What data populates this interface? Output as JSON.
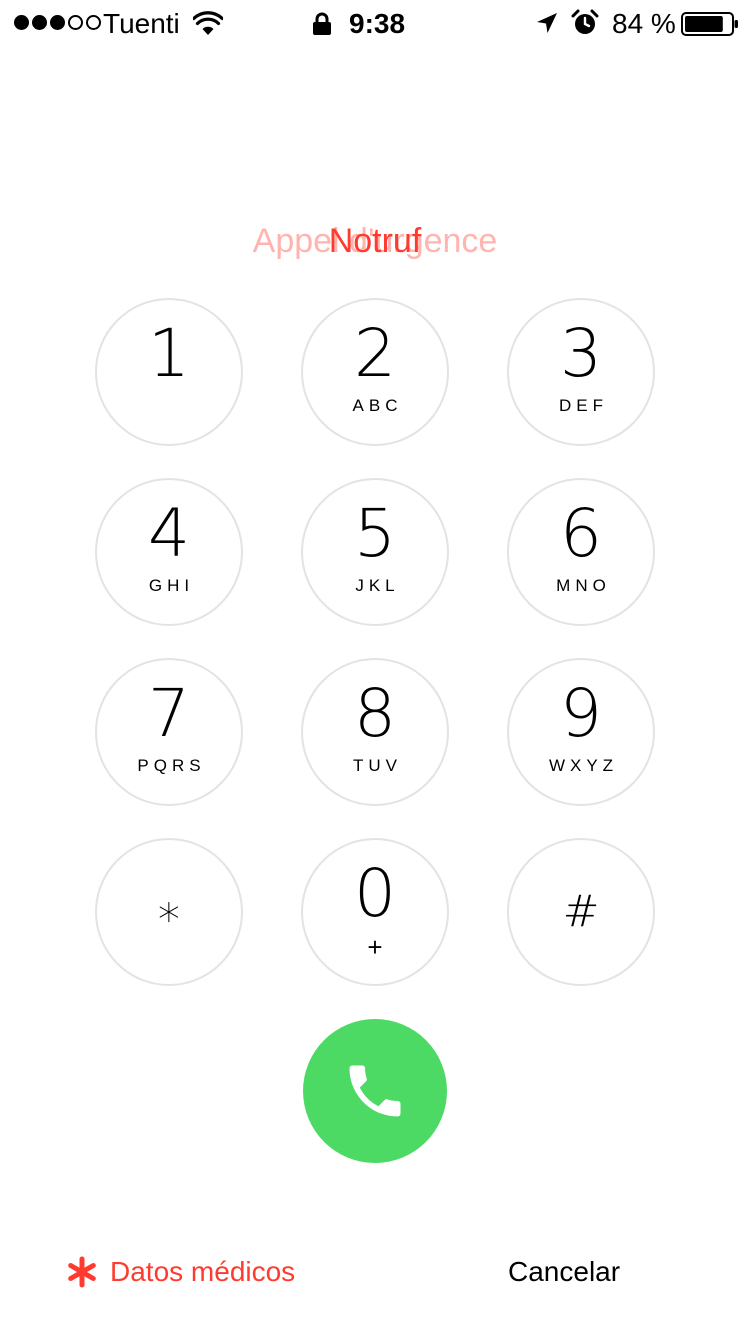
{
  "status_bar": {
    "signal_dots": [
      "filled",
      "filled",
      "filled",
      "empty",
      "empty"
    ],
    "carrier": "Tuenti",
    "wifi_icon": "wifi-icon",
    "lock_icon": "lock-icon",
    "time": "9:38",
    "location_icon": "location-arrow-icon",
    "alarm_icon": "alarm-clock-icon",
    "battery_percent": "84 %",
    "battery_level": 0.84
  },
  "title": {
    "primary": "Notruf",
    "secondary": "Appel d'urgence",
    "color": "#ff3b30"
  },
  "keypad": {
    "keys": [
      {
        "digit": "1",
        "letters": ""
      },
      {
        "digit": "2",
        "letters": "ABC"
      },
      {
        "digit": "3",
        "letters": "DEF"
      },
      {
        "digit": "4",
        "letters": "GHI"
      },
      {
        "digit": "5",
        "letters": "JKL"
      },
      {
        "digit": "6",
        "letters": "MNO"
      },
      {
        "digit": "7",
        "letters": "PQRS"
      },
      {
        "digit": "8",
        "letters": "TUV"
      },
      {
        "digit": "9",
        "letters": "WXYZ"
      },
      {
        "digit": "∗",
        "letters": ""
      },
      {
        "digit": "0",
        "letters": "+"
      },
      {
        "digit": "#",
        "letters": ""
      }
    ],
    "border_color": "#e3e3e3"
  },
  "call_button": {
    "icon": "phone-icon",
    "color": "#4cd964"
  },
  "bottom_bar": {
    "medical_label": "Datos médicos",
    "medical_icon": "asterisk-icon",
    "medical_color": "#ff3b30",
    "cancel_label": "Cancelar"
  }
}
